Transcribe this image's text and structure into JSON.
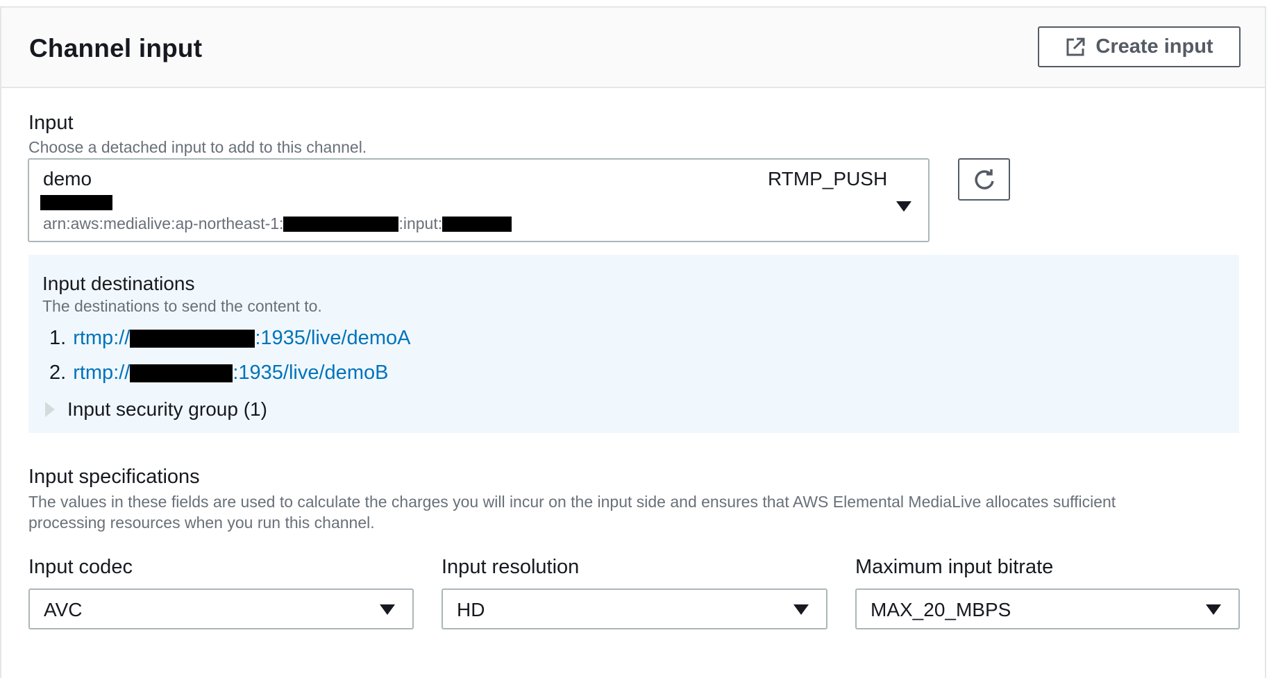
{
  "header": {
    "title": "Channel input",
    "create_button_label": "Create input"
  },
  "input": {
    "label": "Input",
    "description": "Choose a detached input to add to this channel.",
    "selected_name": "demo",
    "selected_type": "RTMP_PUSH",
    "arn_prefix": "arn:aws:medialive:ap-northeast-1:",
    "arn_mid": ":input:"
  },
  "destinations": {
    "title": "Input destinations",
    "description": "The destinations to send the content to.",
    "items": [
      {
        "num": "1.",
        "prefix": "rtmp://",
        "suffix": ":1935/live/demoA"
      },
      {
        "num": "2.",
        "prefix": "rtmp://",
        "suffix": ":1935/live/demoB"
      }
    ],
    "security_group_label": "Input security group (1)"
  },
  "specifications": {
    "label": "Input specifications",
    "description_line1": "The values in these fields are used to calculate the charges you will incur on the input side and ensures that AWS Elemental MediaLive allocates sufficient",
    "description_line2": "processing resources when you run this channel.",
    "codec": {
      "label": "Input codec",
      "value": "AVC"
    },
    "resolution": {
      "label": "Input resolution",
      "value": "HD"
    },
    "bitrate": {
      "label": "Maximum input bitrate",
      "value": "MAX_20_MBPS"
    }
  },
  "icons": {
    "create": "external-link-icon",
    "refresh": "refresh-icon",
    "dropdown": "caret-down-icon",
    "expand": "caret-right-icon"
  },
  "colors": {
    "link": "#0073bb",
    "destination_bg": "#f1f8fd",
    "muted_text": "#687078"
  }
}
